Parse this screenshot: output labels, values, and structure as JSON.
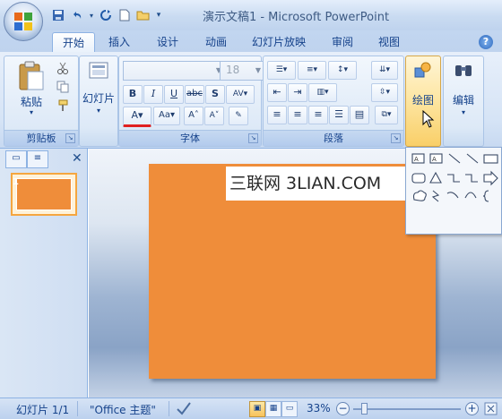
{
  "app": {
    "title": "演示文稿1 - Microsoft PowerPoint"
  },
  "qat": {
    "save_icon": "save-icon",
    "undo_icon": "undo-icon",
    "redo_icon": "redo-icon",
    "new_icon": "new-document-icon",
    "open_icon": "open-folder-icon"
  },
  "tabs": [
    {
      "label": "开始"
    },
    {
      "label": "插入"
    },
    {
      "label": "设计"
    },
    {
      "label": "动画"
    },
    {
      "label": "幻灯片放映"
    },
    {
      "label": "审阅"
    },
    {
      "label": "视图"
    }
  ],
  "ribbon": {
    "clipboard": {
      "group_label": "剪贴板",
      "paste_label": "粘贴"
    },
    "slides": {
      "new_slide_label": "幻灯片"
    },
    "font": {
      "group_label": "字体",
      "size_value": "18"
    },
    "paragraph": {
      "group_label": "段落"
    },
    "drawing": {
      "label": "绘图"
    },
    "editing": {
      "label": "编辑"
    }
  },
  "pane": {
    "thumb_number": "1",
    "close_glyph": "✕"
  },
  "slide": {
    "watermark": "三联网 3LIAN.COM"
  },
  "status": {
    "slide_info": "幻灯片 1/1",
    "theme": "\"Office 主题\"",
    "zoom": "33%",
    "minus": "−",
    "plus": "+"
  },
  "colors": {
    "slide_fill": "#ef8d3a",
    "accent": "#15428b"
  }
}
